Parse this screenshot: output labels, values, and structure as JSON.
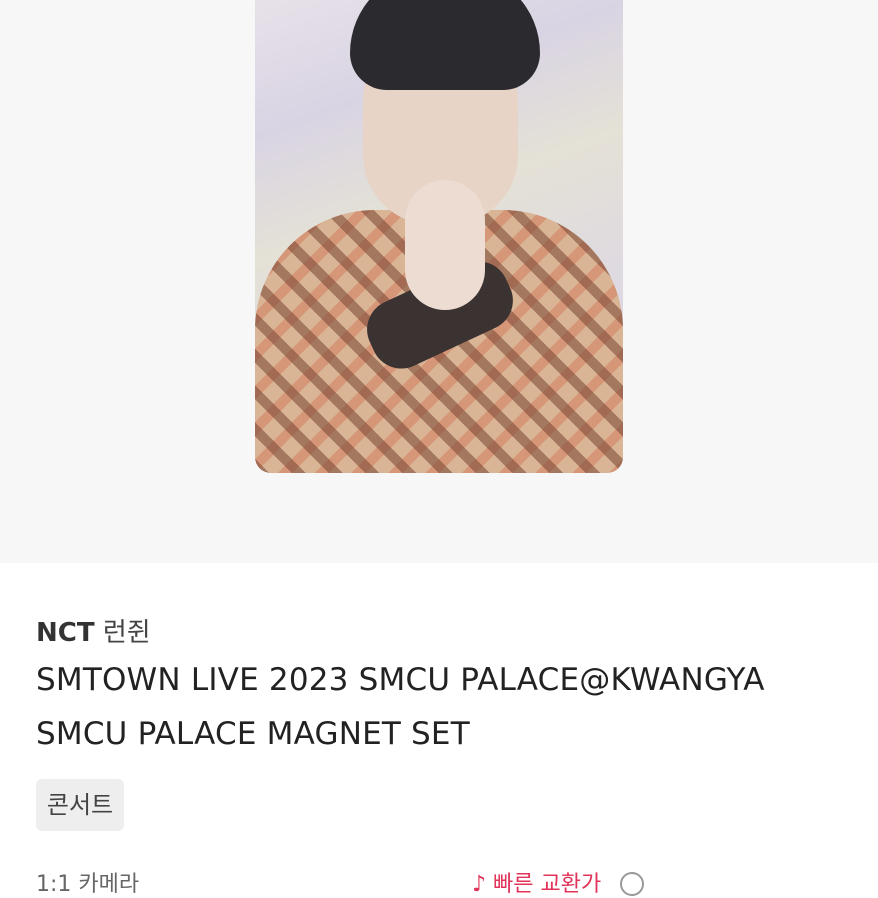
{
  "product": {
    "image_alt": "photocard",
    "artist": "NCT",
    "member": "런쥔",
    "title_line1": "SMTOWN LIVE 2023 SMCU PALACE@KWANGYA",
    "title_line2": "SMCU PALACE MAGNET SET",
    "tag": "콘서트"
  },
  "footer": {
    "left_text": "1:1 카메라",
    "right_text": "♪ 빠른 교환가"
  }
}
